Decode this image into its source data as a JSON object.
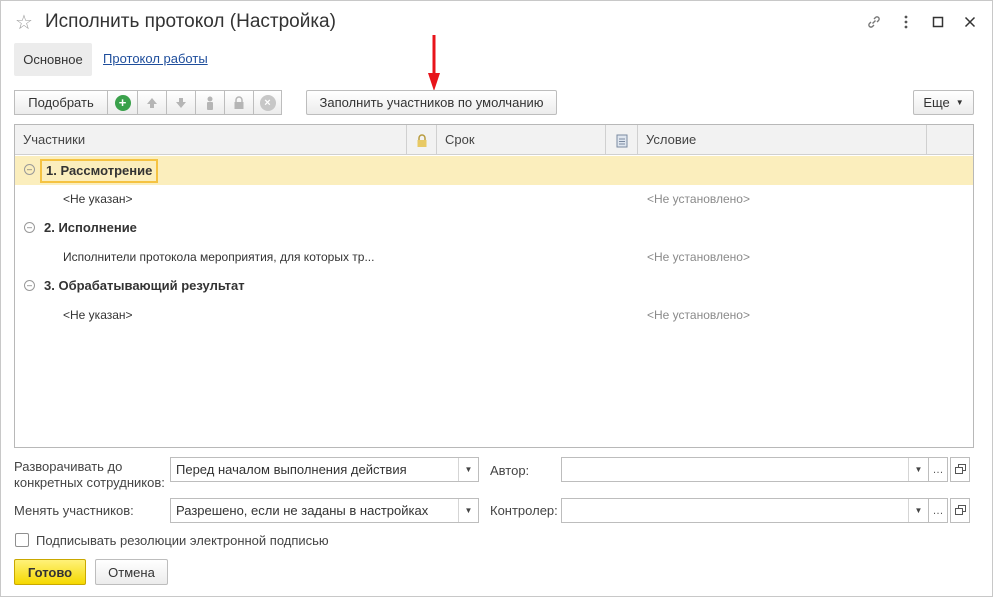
{
  "window": {
    "title": "Исполнить протокол (Настройка)",
    "icons": [
      "star-icon",
      "link-icon",
      "more-icon",
      "maximize-icon",
      "close-icon"
    ]
  },
  "tabs": {
    "main": "Основное",
    "log": "Протокол работы"
  },
  "toolbar": {
    "pick_label": "Подобрать",
    "fill_label": "Заполнить участников по умолчанию",
    "more_label": "Еще"
  },
  "table": {
    "columns": {
      "participants": "Участники",
      "term": "Срок",
      "condition": "Условие"
    },
    "groups": [
      {
        "label": "1. Рассмотрение",
        "participant": "<Не указан>",
        "condition": "<Не установлено>"
      },
      {
        "label": "2. Исполнение",
        "participant": "Исполнители протокола мероприятия, для которых тр...",
        "condition": "<Не установлено>"
      },
      {
        "label": "3. Обрабатывающий результат",
        "participant": "<Не указан>",
        "condition": "<Не установлено>"
      }
    ]
  },
  "form": {
    "expand_label_line1": "Разворачивать до",
    "expand_label_line2": "конкретных сотрудников:",
    "expand_value": "Перед началом выполнения действия",
    "change_label": "Менять участников:",
    "change_value": "Разрешено, если не заданы в настройках",
    "author_label": "Автор:",
    "author_value": "",
    "controller_label": "Контролер:",
    "controller_value": "",
    "sign_label": "Подписывать резолюции электронной подписью",
    "sign_checked": false
  },
  "buttons": {
    "ok": "Готово",
    "cancel": "Отмена"
  },
  "colors": {
    "selected_row": "#fbeebd",
    "ok_button": "#f5d800",
    "link": "#1f4e9c",
    "add_icon": "#3aa14b",
    "arrow": "#e8141b"
  }
}
